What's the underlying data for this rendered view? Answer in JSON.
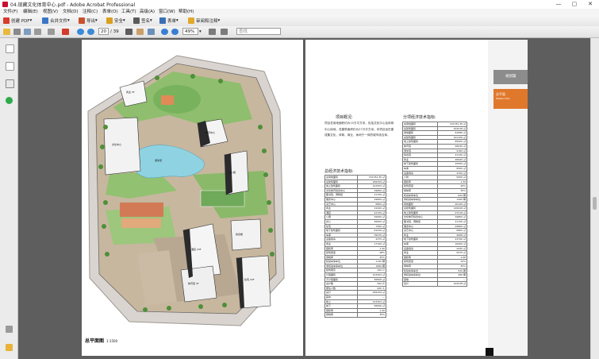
{
  "window": {
    "title": "04.现藏文化体育中心.pdf - Adobe Acrobat Professional",
    "controls": [
      "—",
      "▢",
      "✕"
    ]
  },
  "menu": [
    "文件(F)",
    "编辑(E)",
    "视图(V)",
    "文档(D)",
    "注释(C)",
    "表单(O)",
    "工具(T)",
    "高级(A)",
    "窗口(W)",
    "帮助(H)"
  ],
  "toolbar": {
    "create_pdf": "创建 PDF",
    "combine": "合并文件",
    "export": "导出",
    "secure": "安全",
    "sign": "签名",
    "forms": "表单",
    "review": "审阅和注释"
  },
  "navbar": {
    "current_page": "20",
    "total_pages": "/ 39",
    "zoom": "49%",
    "search_placeholder": "查找"
  },
  "page1": {
    "caption": "总平面图",
    "scale": "1:1500",
    "buildings": [
      "商业 5F",
      "文化中心",
      "体育中心",
      "办公楼",
      "综合楼",
      "酒店 23F",
      "体育馆 3F",
      "住宅 22F",
      "游泳馆"
    ]
  },
  "page2": {
    "overview_title": "项目概况:",
    "overview_text": "项目总用地面积约为15万平方米，包括文化中心及体育中心用地，总建筑面积约为27万平方米。本项目旨在建成集文化、体育、商业、休闲于一体的城市综合体。",
    "table1_title": "总经济技术指标:",
    "table2_title": "分项经济技术指标:",
    "orange_title": "总平面",
    "orange_sub": "Master Plan",
    "gray_title": "规划篇",
    "table1": [
      [
        "总用地面积",
        "151781.30 ㎡"
      ],
      [
        "总建筑面积",
        "269329 ㎡"
      ],
      [
        "地上建筑面积",
        "212503 ㎡"
      ],
      [
        "文化体育综合中心",
        "29800 ㎡"
      ],
      [
        "图书馆、博物馆",
        "21150 ㎡"
      ],
      [
        "展览中心",
        "29800 ㎡"
      ],
      [
        "演艺中心",
        "6800 ㎡"
      ],
      [
        "商业",
        "21000 ㎡"
      ],
      [
        "酒店",
        "22150 ㎡"
      ],
      [
        "公寓",
        "29500 ㎡"
      ],
      [
        "办公",
        "36600 ㎡"
      ],
      [
        "住宅",
        "7300 ㎡"
      ],
      [
        "地下建筑面积",
        "61026 ㎡"
      ],
      [
        "车库",
        "39530 ㎡"
      ],
      [
        "设备用房",
        "4375 ㎡"
      ],
      [
        "商业",
        "17100 ㎡"
      ],
      [
        "容积率",
        "1.40"
      ],
      [
        "建筑密度",
        "28%"
      ],
      [
        "绿地率",
        "35%"
      ],
      [
        "机动车停车位",
        "1140 辆"
      ],
      [
        "非机动车停车位",
        "1680 辆"
      ],
      [
        "建筑限高",
        "100 m"
      ],
      [
        "计容面积",
        "212503 ㎡"
      ],
      [
        "不计容面积",
        "56826 ㎡"
      ],
      [
        "总户数",
        "292 户"
      ],
      [
        "居住人数",
        "935 人"
      ],
      [
        "总计",
        "269329 ㎡"
      ],
      [
        "其中",
        "—"
      ],
      [
        "地上",
        "212503 ㎡"
      ],
      [
        "地下",
        "56826 ㎡"
      ],
      [
        "容积率",
        "1.40"
      ],
      [
        "绿地率",
        "35%"
      ]
    ],
    "table2": [
      [
        "总用地面积",
        "151781.30 ㎡"
      ],
      [
        "总建筑面积",
        "222018 ㎡"
      ],
      [
        "用地面积",
        "61680 ㎡"
      ],
      [
        "总建筑面积",
        "101100 ㎡"
      ],
      [
        "地上建筑面积",
        "85600 ㎡"
      ],
      [
        "体育馆",
        "28030 ㎡"
      ],
      [
        "游泳馆",
        "9160 ㎡"
      ],
      [
        "综合馆",
        "21150 ㎡"
      ],
      [
        "商业",
        "26640 ㎡"
      ],
      [
        "地下建筑面积",
        "15500 ㎡"
      ],
      [
        "车库",
        "8300 ㎡"
      ],
      [
        "设备用房",
        "2150 ㎡"
      ],
      [
        "人防",
        "5050 ㎡"
      ],
      [
        "容积率",
        "1.39"
      ],
      [
        "建筑密度",
        "26%"
      ],
      [
        "绿地率",
        "35%"
      ],
      [
        "机动车停车位",
        "620 辆"
      ],
      [
        "非机动车停车位",
        "1400 辆"
      ],
      [
        "用地面积",
        "90100 ㎡"
      ],
      [
        "总建筑面积",
        "120918 ㎡"
      ],
      [
        "地上建筑面积",
        "97218 ㎡"
      ],
      [
        "文化体育综合中心",
        "29800 ㎡"
      ],
      [
        "图书馆、博物馆",
        "21150 ㎡"
      ],
      [
        "展览中心",
        "29800 ㎡"
      ],
      [
        "演艺中心",
        "6800 ㎡"
      ],
      [
        "商业",
        "9668 ㎡"
      ],
      [
        "地下建筑面积",
        "23700 ㎡"
      ],
      [
        "车库",
        "16400 ㎡"
      ],
      [
        "设备用房",
        "2225 ㎡"
      ],
      [
        "商业",
        "5075 ㎡"
      ],
      [
        "容积率",
        "1.08"
      ],
      [
        "建筑密度",
        "22%"
      ],
      [
        "绿地率",
        "35%"
      ],
      [
        "机动车停车位",
        "520 辆"
      ],
      [
        "非机动车停车位",
        "280 辆"
      ],
      [
        "其他",
        "—"
      ],
      [
        "合计",
        "222018 ㎡"
      ]
    ]
  },
  "colors": {
    "accent_orange": "#e0782c",
    "app_red": "#c8102e",
    "doc_bg": "#5e5e5e"
  }
}
